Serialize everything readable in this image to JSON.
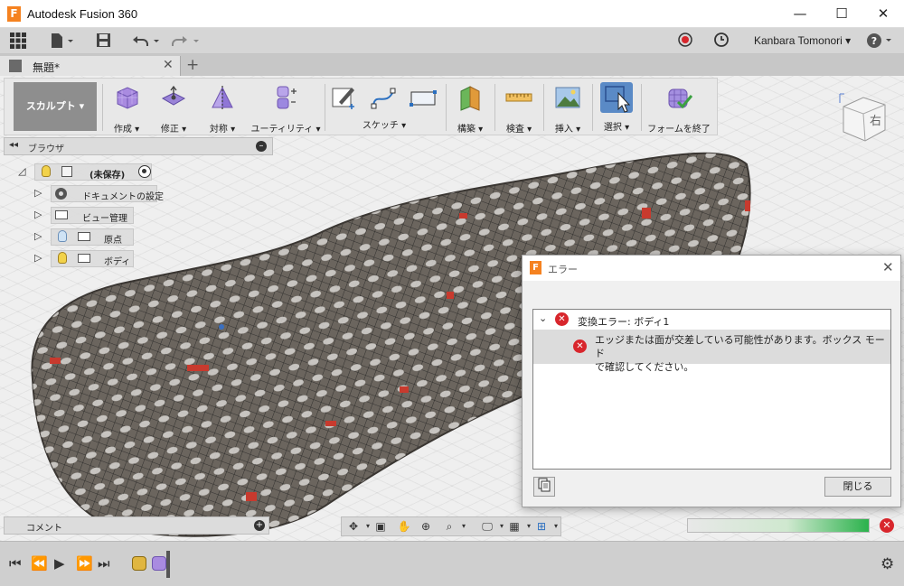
{
  "window": {
    "title": "Autodesk Fusion 360",
    "minimize": "—",
    "maximize": "☐",
    "close": "✕"
  },
  "quick_access": {
    "user": "Kanbara Tomonori ▾",
    "help": "?"
  },
  "document_tab": {
    "name": "無題*",
    "close": "✕",
    "new_tab": "+"
  },
  "toolbar": {
    "workspace": "スカルプト ▾",
    "groups": [
      {
        "label": "作成 ▾",
        "color": "#a98be0"
      },
      {
        "label": "修正 ▾",
        "color": "#9a84d8"
      },
      {
        "label": "対称 ▾",
        "color": "#a58fe0"
      },
      {
        "label": "ユーティリティ ▾",
        "color": "#9c88e0"
      },
      {
        "label": "スケッチ ▾",
        "color": "#ffffff"
      },
      {
        "label": "構築 ▾",
        "color": "#e09a3a"
      },
      {
        "label": "検査 ▾",
        "color": "#e6a03a"
      },
      {
        "label": "挿入 ▾",
        "color": "#6b98c8"
      },
      {
        "label": "選択 ▾",
        "color": "#3b78b8"
      },
      {
        "label": "フォームを終了",
        "color": "#8a78d6"
      }
    ]
  },
  "browser": {
    "label": "ブラウザ",
    "root": "(未保存)",
    "items": [
      {
        "label": "ドキュメントの設定"
      },
      {
        "label": "ビュー管理"
      },
      {
        "label": "原点"
      },
      {
        "label": "ボディ"
      }
    ]
  },
  "comment_bar": {
    "label": "コメント"
  },
  "view_cube": {
    "face": "右"
  },
  "progress": {
    "fill": 1.0,
    "error_mark": "✕"
  },
  "dialog": {
    "title": "エラー",
    "close": "✕",
    "error_heading": "変換エラー: ボディ1",
    "error_message_line1": "エッジまたは面が交差している可能性があります。ボックス モード",
    "error_message_line2": "で確認してください。",
    "close_button": "閉じる"
  },
  "colors": {
    "accent_orange": "#f58220",
    "error_red": "#d8262c",
    "progress_green": "#2bb24c"
  }
}
